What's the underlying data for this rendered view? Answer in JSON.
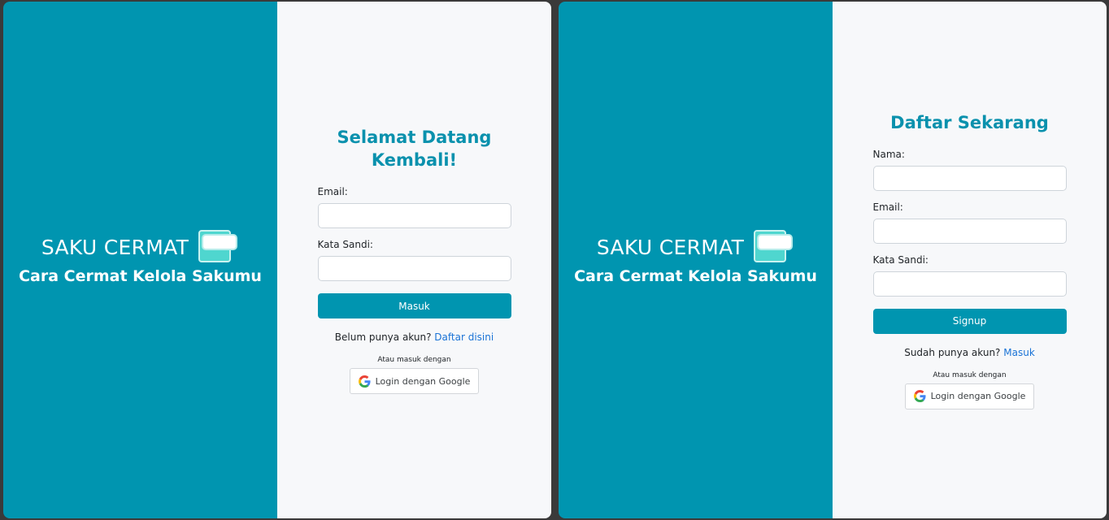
{
  "brand": {
    "title": "SAKU CERMAT",
    "tagline": "Cara Cermat Kelola Sakumu",
    "logo_icon": "wallet-icon"
  },
  "login": {
    "title": "Selamat Datang Kembali!",
    "email_label": "Email:",
    "password_label": "Kata Sandi:",
    "submit_label": "Masuk",
    "switch_text": "Belum punya akun?",
    "switch_link": "Daftar disini",
    "alt_text": "Atau masuk dengan",
    "google_label": "Login dengan Google"
  },
  "signup": {
    "title": "Daftar Sekarang",
    "name_label": "Nama:",
    "email_label": "Email:",
    "password_label": "Kata Sandi:",
    "submit_label": "Signup",
    "switch_text": "Sudah punya akun?",
    "switch_link": "Masuk",
    "alt_text": "Atau masuk dengan",
    "google_label": "Login dengan Google"
  },
  "colors": {
    "brand": "#0095b0",
    "title": "#0a91ad",
    "link": "#1a73d6",
    "form_bg": "#f7f8fa"
  }
}
